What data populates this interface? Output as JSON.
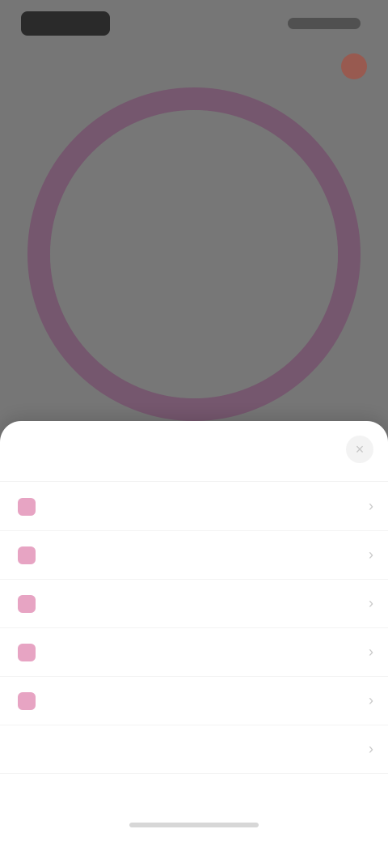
{
  "status": {
    "left": "",
    "right": ""
  },
  "ring": {
    "line1": "",
    "line2": "",
    "value": "",
    "line3": "",
    "line4": ""
  },
  "sheet": {
    "title": "",
    "close_label": "×",
    "options": [
      {
        "label": ""
      },
      {
        "label": ""
      },
      {
        "label": ""
      },
      {
        "label": ""
      },
      {
        "label": ""
      },
      {
        "label": ""
      }
    ]
  },
  "colors": {
    "accent_pink": "#e7a4c3",
    "ring_purple": "#7d5a74",
    "top_icon": "#a85a4d"
  }
}
